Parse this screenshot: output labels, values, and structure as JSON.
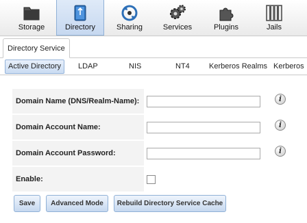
{
  "toolbar": {
    "items": [
      {
        "label": "Storage",
        "icon": "storage-icon"
      },
      {
        "label": "Directory",
        "icon": "directory-icon",
        "active": true
      },
      {
        "label": "Sharing",
        "icon": "sharing-icon"
      },
      {
        "label": "Services",
        "icon": "services-gears-icon"
      },
      {
        "label": "Plugins",
        "icon": "plugins-puzzle-icon"
      },
      {
        "label": "Jails",
        "icon": "jails-icon"
      }
    ]
  },
  "tab": {
    "label": "Directory Service"
  },
  "subtabs": [
    {
      "label": "Active Directory",
      "active": true
    },
    {
      "label": "LDAP"
    },
    {
      "label": "NIS"
    },
    {
      "label": "NT4"
    },
    {
      "label": "Kerberos Realms"
    },
    {
      "label": "Kerberos"
    }
  ],
  "form": {
    "domain_name_label": "Domain Name (DNS/Realm-Name):",
    "domain_name_value": "",
    "account_name_label": "Domain Account Name:",
    "account_name_value": "",
    "account_password_label": "Domain Account Password:",
    "account_password_value": "",
    "enable_label": "Enable:",
    "enable_checked": false,
    "info_glyph": "i"
  },
  "buttons": {
    "save": "Save",
    "advanced": "Advanced Mode",
    "rebuild": "Rebuild Directory Service Cache"
  }
}
